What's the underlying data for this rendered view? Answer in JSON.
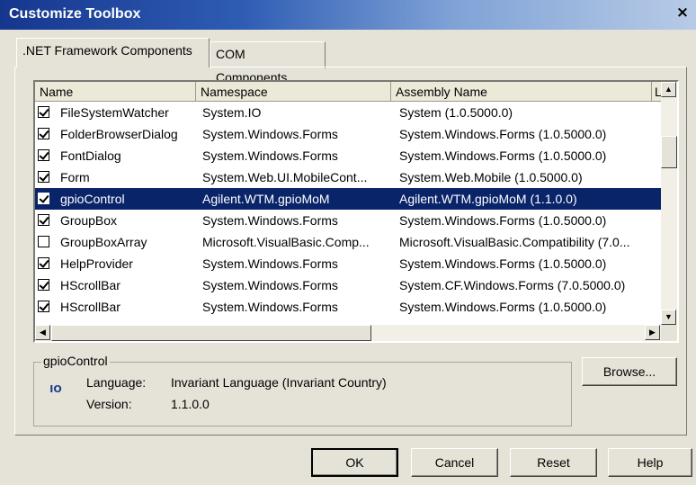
{
  "window": {
    "title": "Customize Toolbox",
    "close_glyph": "×"
  },
  "tabs": [
    {
      "label": ".NET Framework Components",
      "active": true
    },
    {
      "label": "COM Components",
      "active": false
    }
  ],
  "table": {
    "columns": [
      "Name",
      "Namespace",
      "Assembly Name",
      "L"
    ],
    "rows": [
      {
        "checked": true,
        "name": "FileSystemWatcher",
        "namespace": "System.IO",
        "assembly": "System (1.0.5000.0)"
      },
      {
        "checked": true,
        "name": "FolderBrowserDialog",
        "namespace": "System.Windows.Forms",
        "assembly": "System.Windows.Forms (1.0.5000.0)"
      },
      {
        "checked": true,
        "name": "FontDialog",
        "namespace": "System.Windows.Forms",
        "assembly": "System.Windows.Forms (1.0.5000.0)"
      },
      {
        "checked": true,
        "name": "Form",
        "namespace": "System.Web.UI.MobileCont...",
        "assembly": "System.Web.Mobile (1.0.5000.0)"
      },
      {
        "checked": true,
        "name": "gpioControl",
        "namespace": "Agilent.WTM.gpioMoM",
        "assembly": "Agilent.WTM.gpioMoM (1.1.0.0)",
        "selected": true
      },
      {
        "checked": true,
        "name": "GroupBox",
        "namespace": "System.Windows.Forms",
        "assembly": "System.Windows.Forms (1.0.5000.0)"
      },
      {
        "checked": false,
        "name": "GroupBoxArray",
        "namespace": "Microsoft.VisualBasic.Comp...",
        "assembly": "Microsoft.VisualBasic.Compatibility (7.0..."
      },
      {
        "checked": true,
        "name": "HelpProvider",
        "namespace": "System.Windows.Forms",
        "assembly": "System.Windows.Forms (1.0.5000.0)"
      },
      {
        "checked": true,
        "name": "HScrollBar",
        "namespace": "System.Windows.Forms",
        "assembly": "System.CF.Windows.Forms (7.0.5000.0)"
      },
      {
        "checked": true,
        "name": "HScrollBar",
        "namespace": "System.Windows.Forms",
        "assembly": "System.Windows.Forms (1.0.5000.0)"
      }
    ]
  },
  "details": {
    "group_title": "gpioControl",
    "icon": "component-icon",
    "icon_text": "IO",
    "language_label": "Language:",
    "language_value": "Invariant Language (Invariant Country)",
    "version_label": "Version:",
    "version_value": "1.1.0.0"
  },
  "buttons": {
    "browse": "Browse...",
    "ok": "OK",
    "cancel": "Cancel",
    "reset": "Reset",
    "help": "Help"
  },
  "colors": {
    "selection": "#0a246a",
    "titlebar": "#16368e"
  }
}
